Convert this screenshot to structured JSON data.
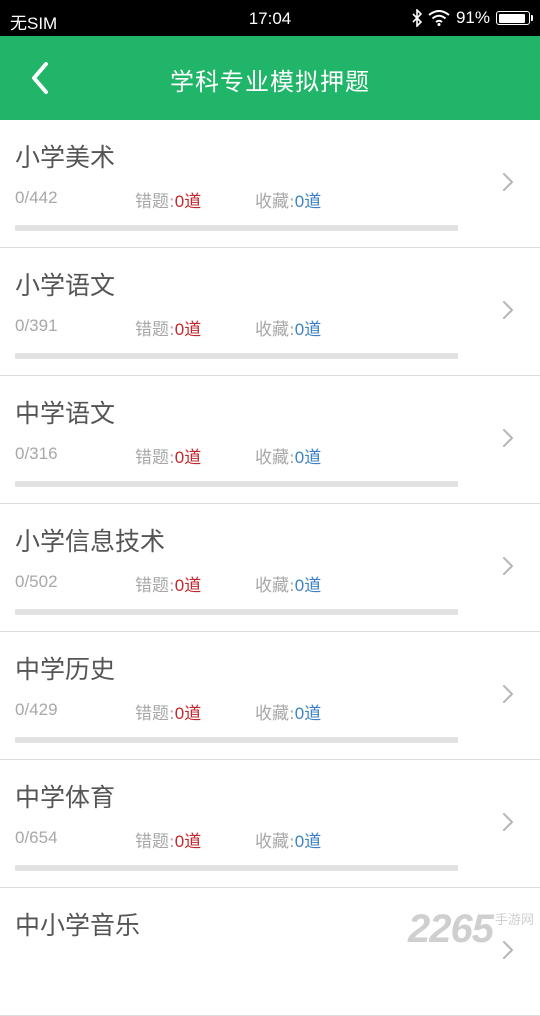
{
  "status_bar": {
    "carrier": "无SIM",
    "time": "17:04",
    "battery_text": "91%",
    "battery_level": 0.91
  },
  "nav": {
    "title": "学科专业模拟押题",
    "back_icon": "chevron-left-icon"
  },
  "labels": {
    "wrong": "错题:",
    "fav": "收藏:"
  },
  "items": [
    {
      "name": "小学美术",
      "progress": "0/442",
      "wrong": "0道",
      "fav": "0道",
      "ratio": 0
    },
    {
      "name": "小学语文",
      "progress": "0/391",
      "wrong": "0道",
      "fav": "0道",
      "ratio": 0
    },
    {
      "name": "中学语文",
      "progress": "0/316",
      "wrong": "0道",
      "fav": "0道",
      "ratio": 0
    },
    {
      "name": "小学信息技术",
      "progress": "0/502",
      "wrong": "0道",
      "fav": "0道",
      "ratio": 0
    },
    {
      "name": "中学历史",
      "progress": "0/429",
      "wrong": "0道",
      "fav": "0道",
      "ratio": 0
    },
    {
      "name": "中学体育",
      "progress": "0/654",
      "wrong": "0道",
      "fav": "0道",
      "ratio": 0
    },
    {
      "name": "中小学音乐",
      "progress": "",
      "wrong": "",
      "fav": "",
      "ratio": 0
    }
  ],
  "watermark": {
    "big": "2265",
    "small": "手游网"
  },
  "colors": {
    "primary": "#21b56a",
    "wrong_value": "#c0272d",
    "fav_value": "#3b82c4"
  }
}
